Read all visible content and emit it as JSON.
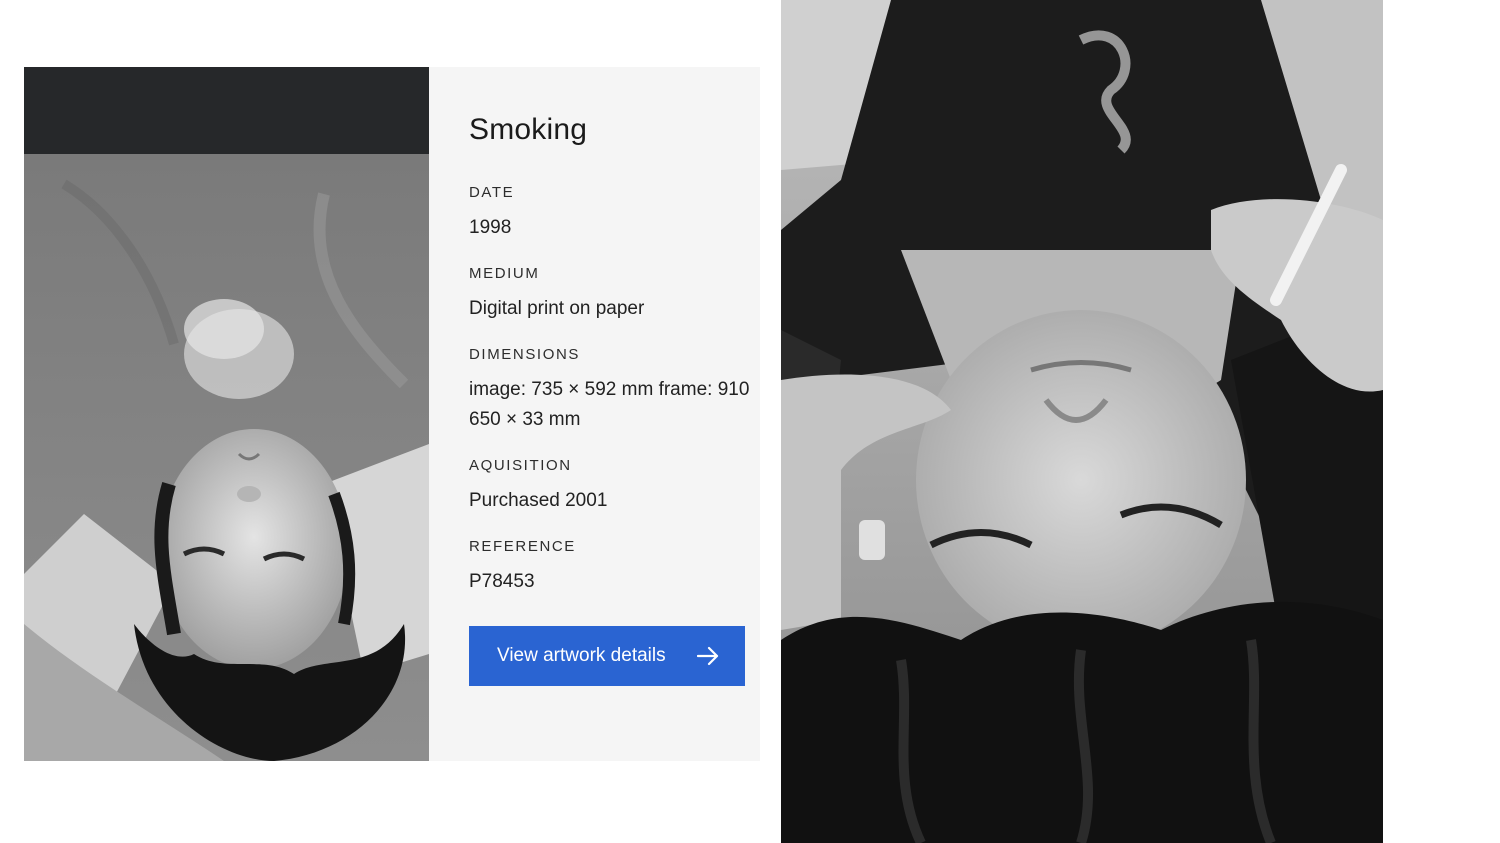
{
  "artwork": {
    "title": "Smoking",
    "fields": [
      {
        "label": "DATE",
        "value": "1998"
      },
      {
        "label": "MEDIUM",
        "value": "Digital print on paper"
      },
      {
        "label": "DIMENSIONS",
        "value": "image: 735 × 592 mm frame: 910",
        "value2": "650 × 33 mm"
      },
      {
        "label": "AQUISITION",
        "value": "Purchased 2001"
      },
      {
        "label": "REFERENCE",
        "value": "P78453"
      }
    ],
    "cta_label": "View artwork details",
    "cta_icon": "arrow-right-icon"
  },
  "colors": {
    "card_background": "#f5f5f5",
    "button_blue": "#2a64d2",
    "image_header_dark": "#26282a"
  }
}
